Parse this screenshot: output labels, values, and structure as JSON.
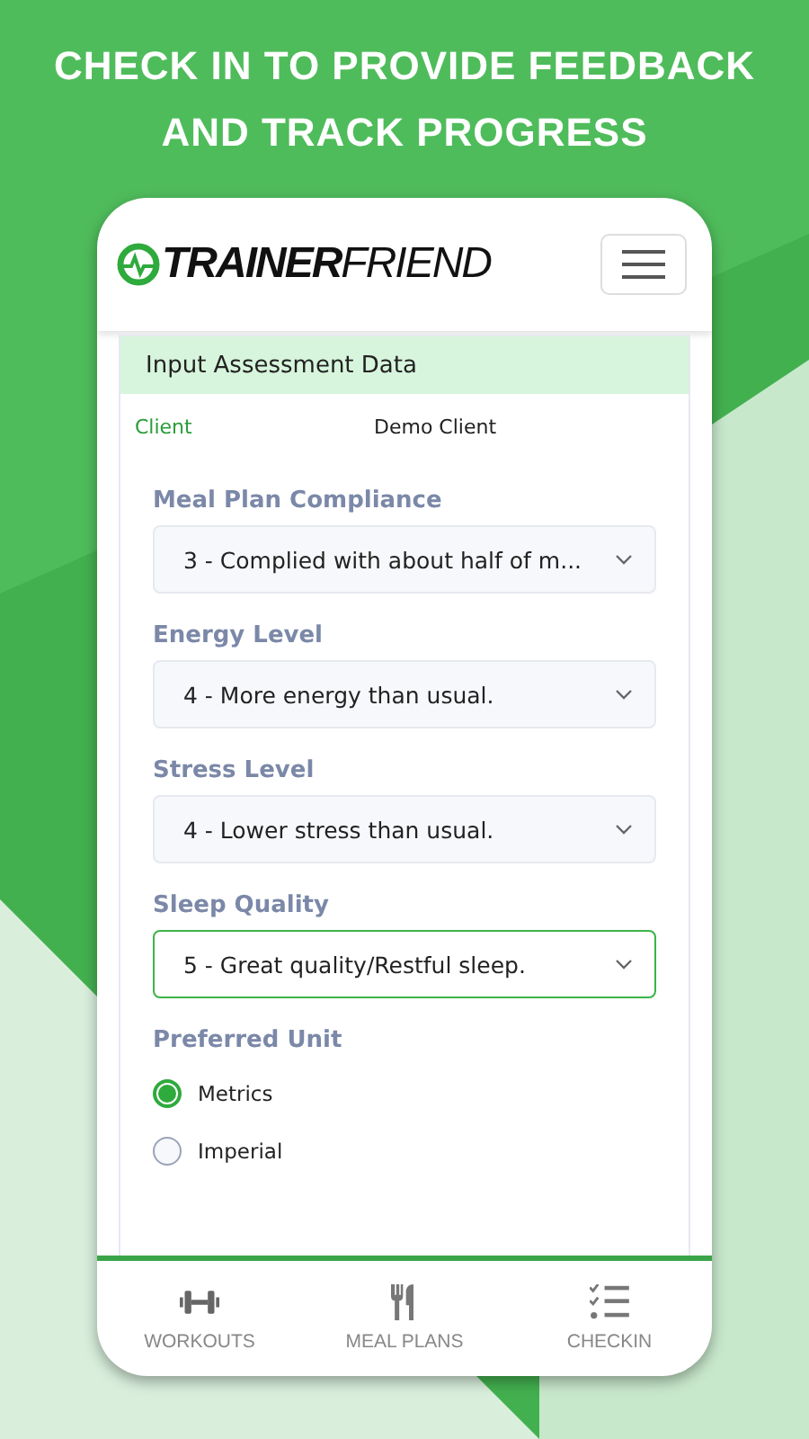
{
  "headline": [
    "CHECK IN TO PROVIDE FEEDBACK",
    "AND TRACK PROGRESS"
  ],
  "logo": {
    "bold": "TRAINER",
    "light": "FRIEND"
  },
  "card": {
    "title": "Input Assessment Data",
    "client_label": "Client",
    "client_value": "Demo Client"
  },
  "fields": [
    {
      "label": "Meal Plan Compliance",
      "value": "3 - Complied with about half of m...",
      "focused": false
    },
    {
      "label": "Energy Level",
      "value": "4 - More energy than usual.",
      "focused": false
    },
    {
      "label": "Stress Level",
      "value": "4 - Lower stress than usual.",
      "focused": false
    },
    {
      "label": "Sleep Quality",
      "value": "5 - Great quality/Restful sleep.",
      "focused": true
    }
  ],
  "unit": {
    "label": "Preferred Unit",
    "options": [
      {
        "label": "Metrics",
        "selected": true
      },
      {
        "label": "Imperial",
        "selected": false
      }
    ]
  },
  "nav": [
    {
      "kind": "workouts",
      "label": "WORKOUTS"
    },
    {
      "kind": "meals",
      "label": "MEAL PLANS"
    },
    {
      "kind": "checkin",
      "label": "CHECKIN"
    }
  ]
}
